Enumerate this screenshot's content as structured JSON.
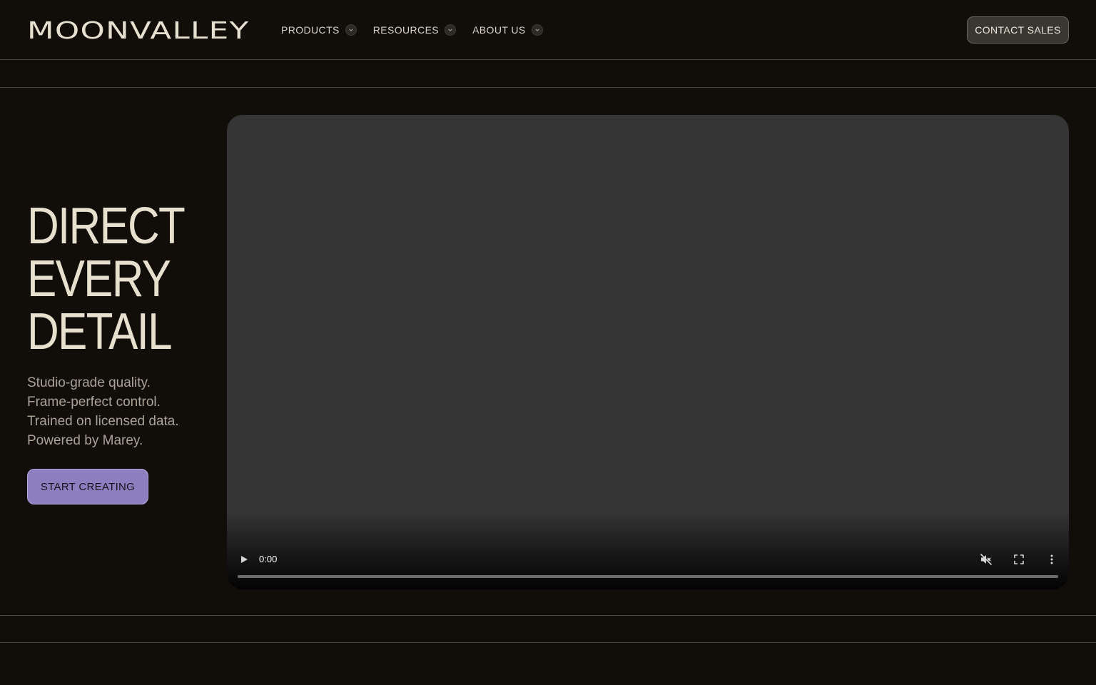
{
  "header": {
    "logo": "MOONVALLEY",
    "nav": [
      {
        "label": "PRODUCTS"
      },
      {
        "label": "RESOURCES"
      },
      {
        "label": "ABOUT US"
      }
    ],
    "contact_label": "CONTACT SALES"
  },
  "hero": {
    "title_lines": [
      "DIRECT",
      "EVERY",
      "DETAIL"
    ],
    "subtitle_lines": [
      "Studio-grade quality.",
      "Frame-perfect control.",
      "Trained on licensed data.",
      "Powered by Marey."
    ],
    "cta_label": "START CREATING"
  },
  "video": {
    "time": "0:00",
    "progress": 0,
    "icons": [
      "play-icon",
      "mute-icon",
      "fullscreen-icon",
      "more-options-icon"
    ]
  },
  "colors": {
    "background": "#110e0a",
    "accent": "#8c7fc0",
    "text": "#e7e0cf"
  }
}
